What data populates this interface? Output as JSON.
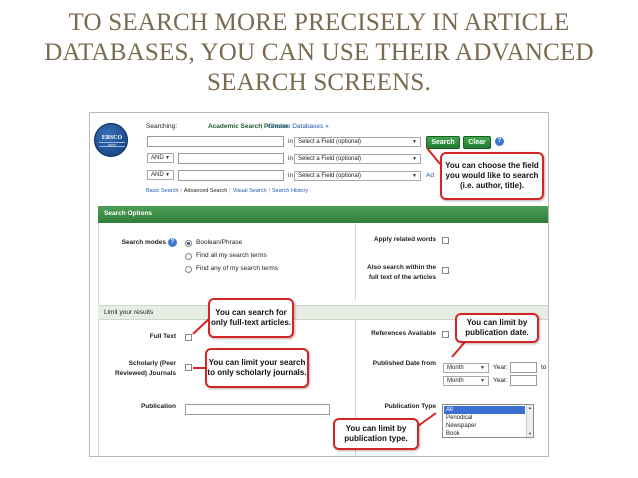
{
  "slide": {
    "title_lines": [
      "TO SEARCH MORE PRECISELY IN ARTICLE",
      "DATABASES, YOU CAN USE THEIR ADVANCED",
      "SEARCH SCREENS."
    ]
  },
  "header": {
    "logo_text": "EBSCO",
    "logo_subtext": "HOST",
    "searching_label": "Searching:",
    "database_name": "Academic Search Premier",
    "separator": "|",
    "choose_databases": "Choose Databases »"
  },
  "search_rows": [
    {
      "operator": "",
      "term": "",
      "in_label": "in",
      "field": "Select a Field (optional)"
    },
    {
      "operator": "AND",
      "term": "",
      "in_label": "in",
      "field": "Select a Field (optional)"
    },
    {
      "operator": "AND",
      "term": "",
      "in_label": "in",
      "field": "Select a Field (optional)"
    }
  ],
  "buttons": {
    "search": "Search",
    "clear": "Clear",
    "help": "?",
    "add_row": "Ad"
  },
  "nav_links": {
    "basic": "Basic Search",
    "advanced": "Advanced Search",
    "visual": "Visual Search",
    "history": "Search History",
    "pipe": "|"
  },
  "search_options": {
    "header": "Search Options",
    "modes_label": "Search modes",
    "modes": [
      "Boolean/Phrase",
      "Find all my search terms",
      "Find any of my search terms"
    ],
    "selected_mode": 0,
    "apply_related": "Apply related words",
    "also_search_full_text": "Also search within the full text of the articles"
  },
  "limits": {
    "header": "Limit your results",
    "full_text": "Full Text",
    "scholarly": "Scholarly (Peer Reviewed) Journals",
    "publication": "Publication",
    "references_available": "References Available",
    "published_date_from": "Published Date from",
    "month": "Month",
    "year": "Year:",
    "to": "to",
    "publication_type": "Publication Type",
    "publication_types": [
      "All",
      "Periodical",
      "Newspaper",
      "Book"
    ],
    "selected_type": "All"
  },
  "callouts": {
    "field": "You can choose the field you would like to search (i.e. author, title).",
    "full_text": "You can search for only full-text articles.",
    "scholarly": "You can limit your search to only scholarly journals.",
    "date": "You can limit by publication date.",
    "type": "You can limit by publication type."
  },
  "colors": {
    "title": "#7a6a4f",
    "green_button": "#2f8f3d",
    "callout_border": "#d52424",
    "options_bar": "#3d8a45",
    "link": "#2255aa"
  }
}
